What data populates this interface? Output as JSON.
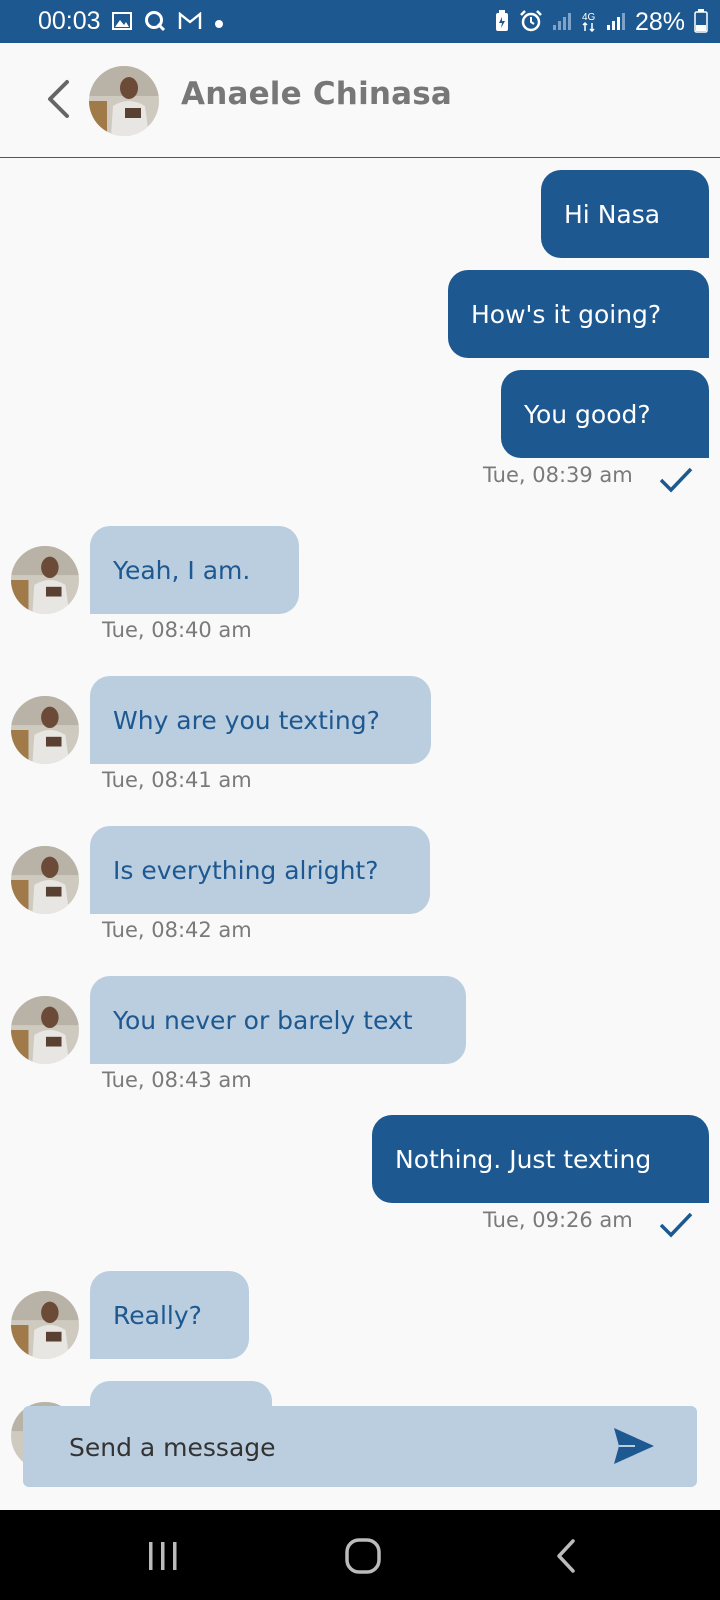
{
  "status_bar": {
    "time": "00:03",
    "battery": "28%",
    "left_icons": [
      "gallery-icon",
      "q-app-icon",
      "gmail-icon",
      "dot-icon"
    ],
    "right_icons": [
      "battery-saver-icon",
      "alarm-icon",
      "signal-icon",
      "4g-icon",
      "signal-icon"
    ]
  },
  "header": {
    "contact_name": "Anaele Chinasa"
  },
  "messages": [
    {
      "direction": "out",
      "text": "Hi Nasa"
    },
    {
      "direction": "out",
      "text": "How's it going?"
    },
    {
      "direction": "out",
      "text": "You good?",
      "time": "Tue, 08:39 am",
      "status": "sent"
    },
    {
      "direction": "in",
      "text": "Yeah, I am.",
      "time": "Tue, 08:40 am"
    },
    {
      "direction": "in",
      "text": "Why are you texting?",
      "time": "Tue, 08:41 am"
    },
    {
      "direction": "in",
      "text": "Is everything alright?",
      "time": "Tue, 08:42 am"
    },
    {
      "direction": "in",
      "text": "You never or barely text",
      "time": "Tue, 08:43 am"
    },
    {
      "direction": "out",
      "text": "Nothing. Just texting",
      "time": "Tue, 09:26 am",
      "status": "sent"
    },
    {
      "direction": "in",
      "text": "Really?"
    },
    {
      "direction": "in",
      "text": ""
    }
  ],
  "composer": {
    "placeholder": "Send a message",
    "value": ""
  },
  "colors": {
    "accent": "#1e5891",
    "incoming_bubble": "#bacedf",
    "background": "#f9f9f9"
  }
}
